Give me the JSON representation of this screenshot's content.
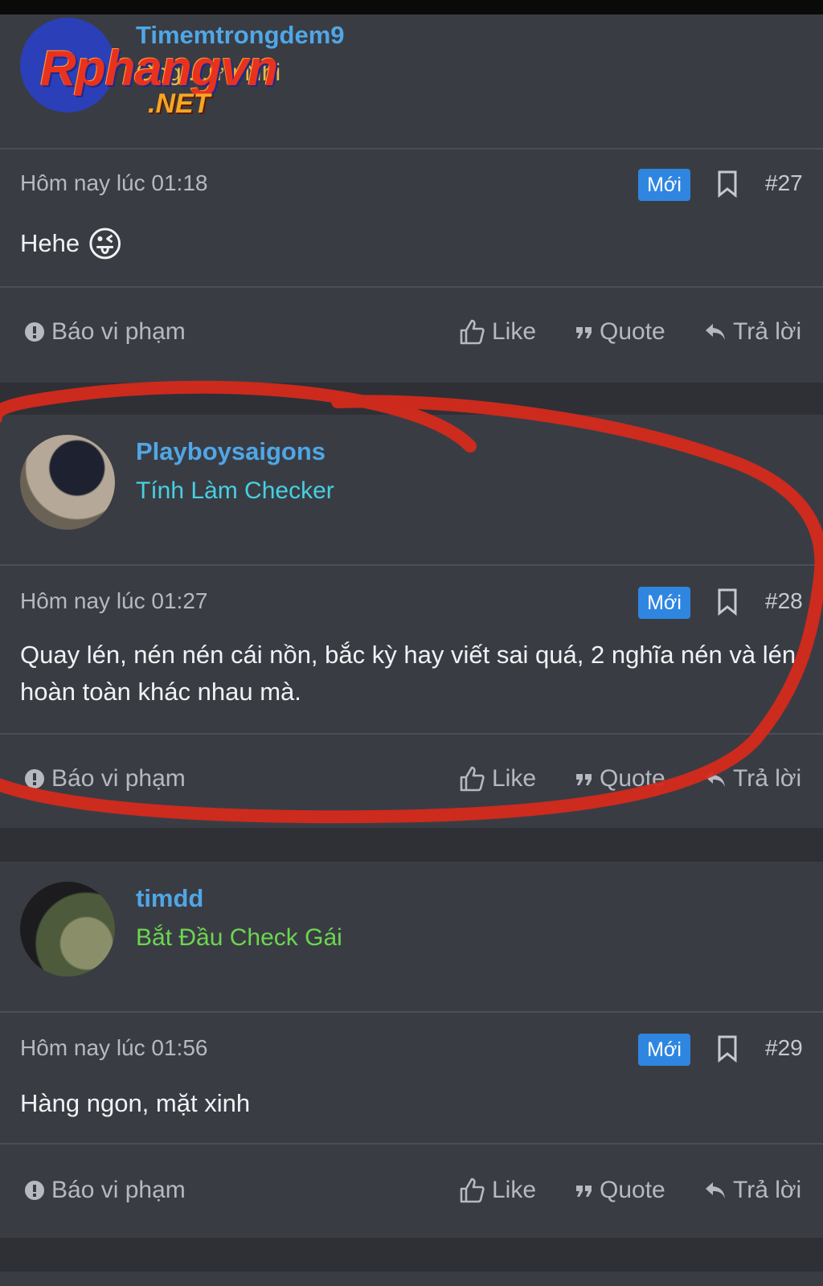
{
  "posts": [
    {
      "username": "Timemtrongdem9",
      "user_title": "Ông ...ưu Nhi",
      "user_title_color": "#e6b94a",
      "timestamp": "Hôm nay lúc 01:18",
      "badge": "Mới",
      "number": "#27",
      "content": "Hehe",
      "emoji": "😜",
      "actions": {
        "report": "Báo vi phạm",
        "like": "Like",
        "quote": "Quote",
        "reply": "Trả lời"
      }
    },
    {
      "username": "Playboysaigons",
      "user_title": "Tính Làm Checker",
      "user_title_color": "#46d0e0",
      "timestamp": "Hôm nay lúc 01:27",
      "badge": "Mới",
      "number": "#28",
      "content": "Quay lén, nén nén cái nồn, bắc kỳ hay viết sai quá, 2 nghĩa nén và lén hoàn toàn khác nhau mà.",
      "actions": {
        "report": "Báo vi phạm",
        "like": "Like",
        "quote": "Quote",
        "reply": "Trả lời"
      }
    },
    {
      "username": "timdd",
      "user_title": "Bắt Đầu Check Gái",
      "user_title_color": "#6cd64f",
      "timestamp": "Hôm nay lúc 01:56",
      "badge": "Mới",
      "number": "#29",
      "content": "Hàng ngon, mặt xinh",
      "actions": {
        "report": "Báo vi phạm",
        "like": "Like",
        "quote": "Quote",
        "reply": "Trả lời"
      }
    }
  ],
  "watermark": {
    "main": "Rphangvn",
    "sub": ".NET"
  },
  "colors": {
    "accent": "#4fa7e6",
    "badge": "#2f86e0",
    "annotation": "#d42a1c"
  }
}
